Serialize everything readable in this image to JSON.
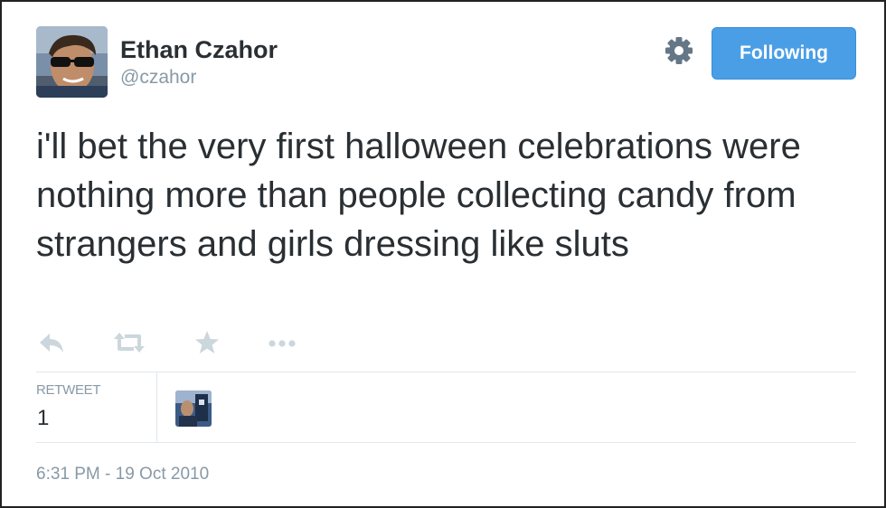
{
  "user": {
    "name": "Ethan Czahor",
    "handle": "@czahor",
    "avatar": "profile-photo"
  },
  "header": {
    "settings_icon": "gear-icon",
    "follow_label": "Following",
    "follow_color": "#4a9ee6"
  },
  "tweet": {
    "text": "i'll bet the very first halloween celebrations were nothing more than people collecting candy from strangers and girls dressing like sluts"
  },
  "actions": [
    {
      "icon": "reply-icon"
    },
    {
      "icon": "retweet-icon"
    },
    {
      "icon": "favorite-star-icon"
    },
    {
      "icon": "more-dots-icon"
    }
  ],
  "stats": {
    "retweet_label": "RETWEET",
    "retweet_count": "1",
    "retweeter_avatar": "retweeter-avatar"
  },
  "timestamp": "6:31 PM - 19 Oct 2010",
  "colors": {
    "text": "#292f33",
    "muted": "#8899a6",
    "icon": "#ccd6dd",
    "divider": "#e1e8ed"
  }
}
